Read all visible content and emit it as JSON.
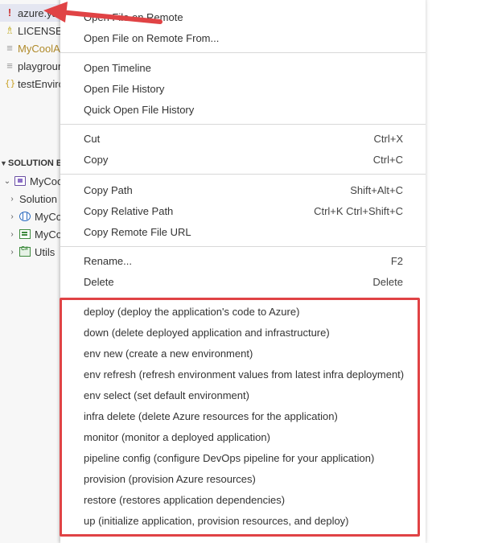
{
  "explorer": {
    "files": [
      {
        "icon": "!",
        "name": "azure.yaml",
        "selected": true
      },
      {
        "icon": "license",
        "name": "LICENSE.md"
      },
      {
        "icon": "lines",
        "name": "MyCoolApp",
        "modified": true
      },
      {
        "icon": "lines",
        "name": "playground"
      },
      {
        "icon": "{}",
        "name": "testEnvironment"
      }
    ],
    "solution_header": "SOLUTION EXPLORER",
    "tree": [
      {
        "chevron": "⌄",
        "name": "MyCoolApp"
      },
      {
        "chevron": "›",
        "name": "Solution Items"
      },
      {
        "chevron": "›",
        "name": "MyCoolApp.Web"
      },
      {
        "chevron": "›",
        "name": "MyCoolApp.Api"
      },
      {
        "chevron": "›",
        "name": "Utils"
      }
    ]
  },
  "menu": {
    "items": [
      {
        "label": "Open File on Remote",
        "shortcut": ""
      },
      {
        "label": "Open File on Remote From...",
        "shortcut": ""
      },
      {
        "label": "Open Timeline",
        "shortcut": ""
      },
      {
        "label": "Open File History",
        "shortcut": ""
      },
      {
        "label": "Quick Open File History",
        "shortcut": ""
      },
      {
        "label": "Cut",
        "shortcut": "Ctrl+X"
      },
      {
        "label": "Copy",
        "shortcut": "Ctrl+C"
      },
      {
        "label": "Copy Path",
        "shortcut": "Shift+Alt+C"
      },
      {
        "label": "Copy Relative Path",
        "shortcut": "Ctrl+K Ctrl+Shift+C"
      },
      {
        "label": "Copy Remote File URL",
        "shortcut": ""
      },
      {
        "label": "Rename...",
        "shortcut": "F2"
      },
      {
        "label": "Delete",
        "shortcut": "Delete"
      },
      {
        "label": "deploy (deploy the application's code to Azure)",
        "shortcut": ""
      },
      {
        "label": "down (delete deployed application and infrastructure)",
        "shortcut": ""
      },
      {
        "label": "env new (create a new environment)",
        "shortcut": ""
      },
      {
        "label": "env refresh (refresh environment values from latest infra deployment)",
        "shortcut": ""
      },
      {
        "label": "env select (set default environment)",
        "shortcut": ""
      },
      {
        "label": "infra delete (delete Azure resources for the application)",
        "shortcut": ""
      },
      {
        "label": "monitor (monitor a deployed application)",
        "shortcut": ""
      },
      {
        "label": "pipeline config (configure DevOps pipeline for your application)",
        "shortcut": ""
      },
      {
        "label": "provision (provision Azure resources)",
        "shortcut": ""
      },
      {
        "label": "restore (restores application dependencies)",
        "shortcut": ""
      },
      {
        "label": "up (initialize application, provision resources, and deploy)",
        "shortcut": ""
      }
    ]
  },
  "colors": {
    "highlight": "#e04345",
    "arrow": "#e04345",
    "selection": "#e4e6f1"
  }
}
